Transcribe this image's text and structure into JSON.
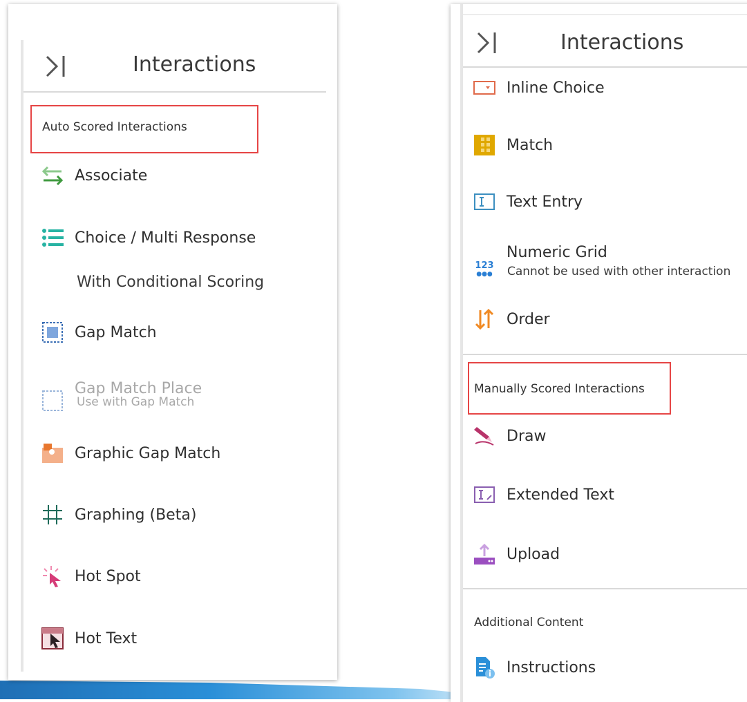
{
  "left_panel": {
    "header": {
      "title": "Interactions",
      "collapse_icon": "collapse-right-icon"
    },
    "section_title": "Auto Scored Interactions",
    "items": [
      {
        "label": "Associate",
        "icon": "associate-icon"
      },
      {
        "label": "Choice / Multi Response",
        "icon": "choice-list-icon",
        "sub": "With Conditional Scoring"
      },
      {
        "label": "Gap Match",
        "icon": "gap-match-icon"
      },
      {
        "label": "Gap Match Place",
        "icon": "gap-match-place-icon",
        "sub": "Use with Gap Match",
        "disabled": true
      },
      {
        "label": "Graphic Gap Match",
        "icon": "graphic-gap-match-icon"
      },
      {
        "label": "Graphing (Beta)",
        "icon": "graphing-grid-icon"
      },
      {
        "label": "Hot Spot",
        "icon": "hot-spot-icon"
      },
      {
        "label": "Hot Text",
        "icon": "hot-text-icon"
      }
    ]
  },
  "right_panel": {
    "header": {
      "title": "Interactions",
      "collapse_icon": "collapse-right-icon"
    },
    "auto_items": [
      {
        "label": "Inline Choice",
        "icon": "inline-choice-icon"
      },
      {
        "label": "Match",
        "icon": "match-grid-icon"
      },
      {
        "label": "Text Entry",
        "icon": "text-entry-icon"
      },
      {
        "label": "Numeric Grid",
        "icon": "numeric-grid-icon",
        "icon_text": "123",
        "sub": "Cannot be used with other interaction"
      },
      {
        "label": "Order",
        "icon": "order-arrows-icon"
      }
    ],
    "manual_section_title": "Manually Scored Interactions",
    "manual_items": [
      {
        "label": "Draw",
        "icon": "draw-pen-icon"
      },
      {
        "label": "Extended Text",
        "icon": "extended-text-icon"
      },
      {
        "label": "Upload",
        "icon": "upload-icon"
      }
    ],
    "additional_section_title": "Additional Content",
    "additional_items": [
      {
        "label": "Instructions",
        "icon": "instructions-icon"
      }
    ]
  },
  "colors": {
    "highlight_border": "#e64545",
    "associate": "#3f9a3f",
    "choice": "#27b3a3",
    "gap_match": "#3b6fb5",
    "graphic_gap": "#e8772e",
    "graphing": "#1f6b5a",
    "hot_spot": "#d63c78",
    "hot_text": "#8a2b3a",
    "inline_choice": "#e06a4a",
    "match": "#e0a800",
    "text_entry": "#3c8fc0",
    "numeric": "#2a7fd4",
    "order": "#f08a24",
    "draw": "#b8336a",
    "extended_text": "#8a5fb0",
    "upload": "#9b4fc0",
    "instructions": "#2a8fd8"
  }
}
